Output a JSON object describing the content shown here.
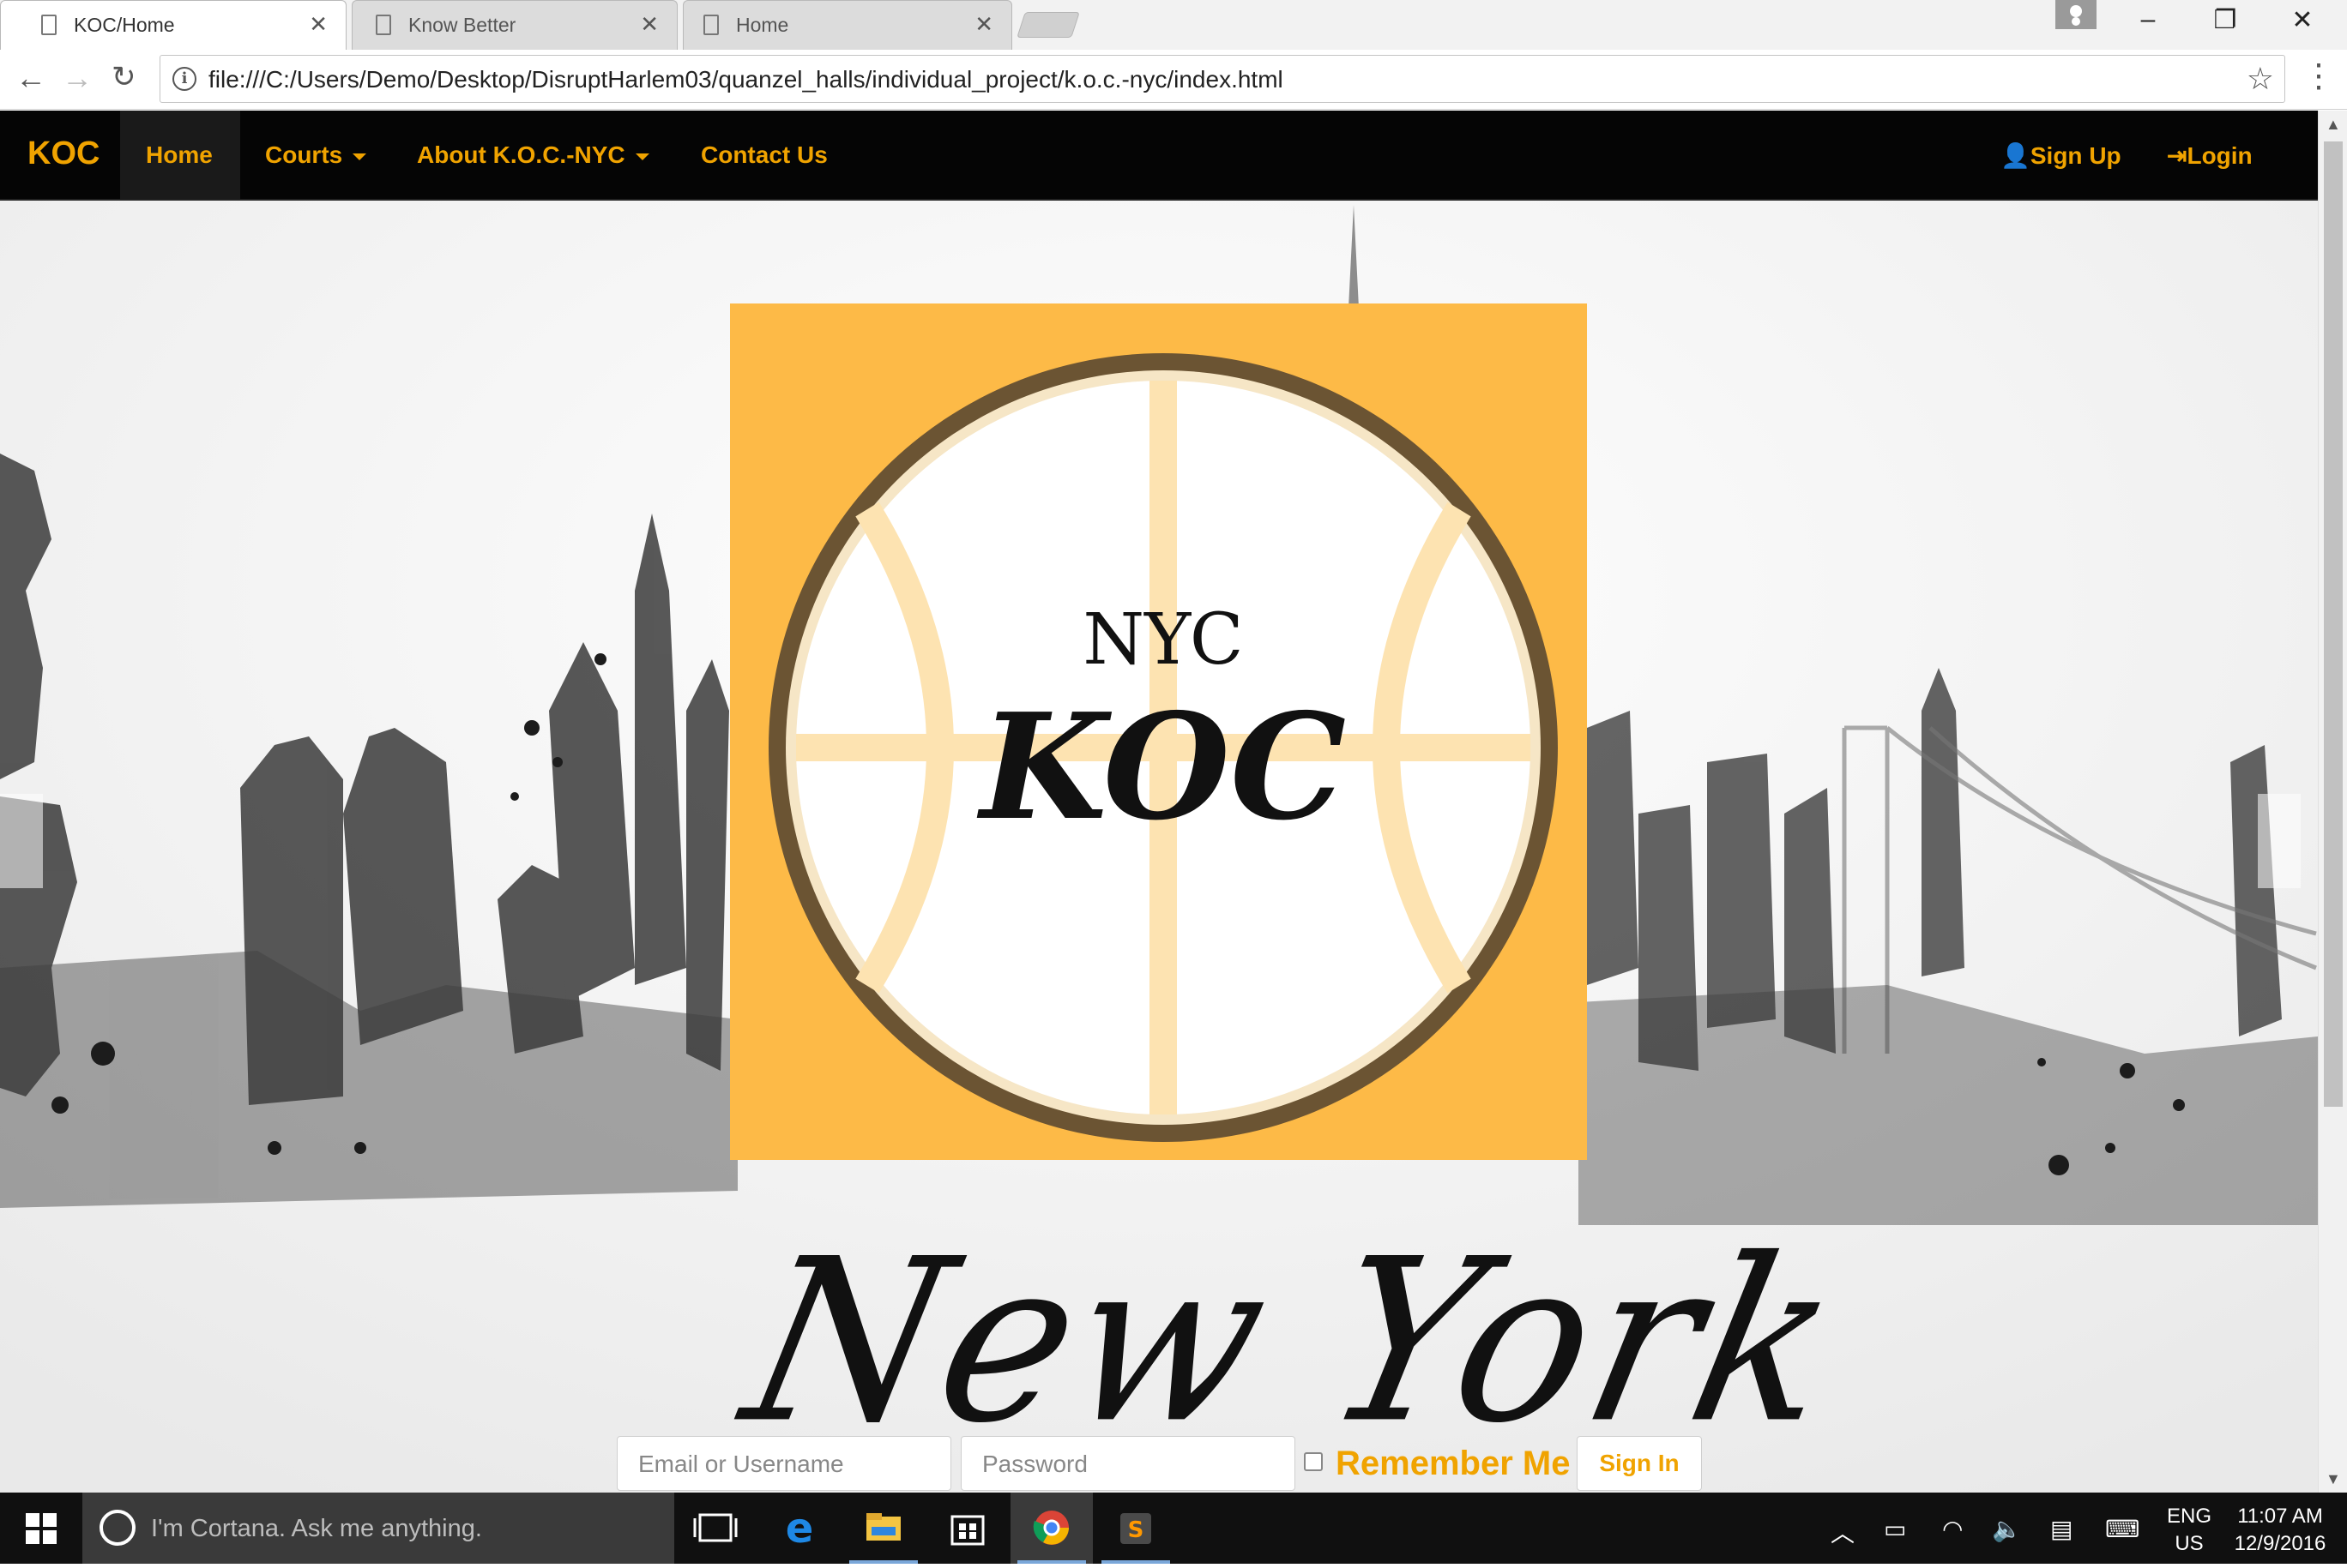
{
  "browser": {
    "tabs": [
      {
        "title": "KOC/Home",
        "active": true
      },
      {
        "title": "Know Better",
        "active": false
      },
      {
        "title": "Home",
        "active": false
      }
    ],
    "url": "file:///C:/Users/Demo/Desktop/DisruptHarlem03/quanzel_halls/individual_project/k.o.c.-nyc/index.html"
  },
  "navbar": {
    "brand": "KOC",
    "links": {
      "home": "Home",
      "courts": "Courts",
      "about": "About K.O.C.-NYC",
      "contact": "Contact Us"
    },
    "signup": "Sign Up",
    "login": "Login"
  },
  "logo": {
    "line1": "NYC",
    "line2": "KOC"
  },
  "hero": {
    "script_text": "New York"
  },
  "signin_form": {
    "email_placeholder": "Email or Username",
    "password_placeholder": "Password",
    "remember_label": "Remember Me",
    "submit_label": "Sign In"
  },
  "taskbar": {
    "cortana_placeholder": "I'm Cortana. Ask me anything.",
    "lang_top": "ENG",
    "lang_bottom": "US",
    "time": "11:07 AM",
    "date": "12/9/2016"
  },
  "colors": {
    "accent": "#f0a300",
    "logo_background": "#fdba47",
    "navbar_background": "#050505"
  }
}
